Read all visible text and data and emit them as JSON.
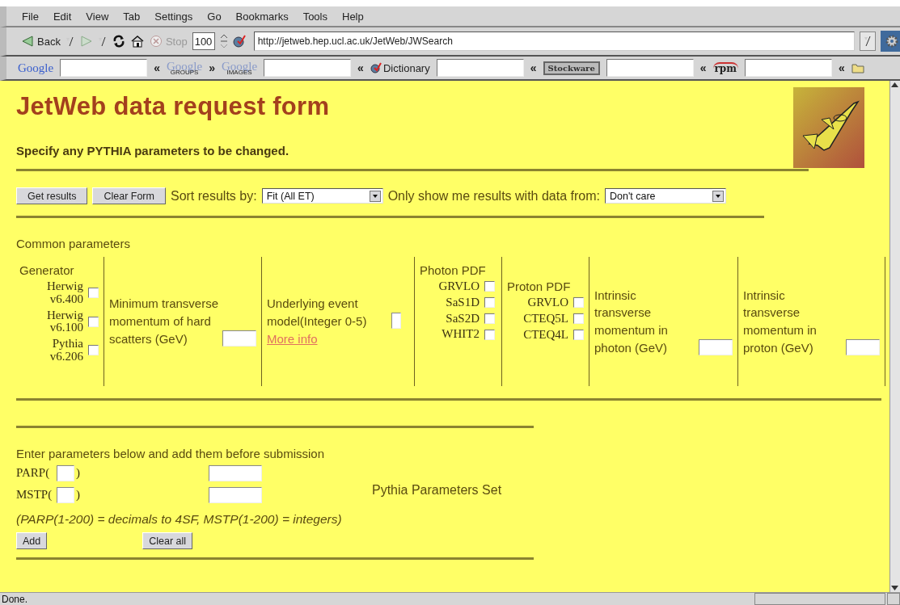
{
  "menu_bar": [
    "File",
    "Edit",
    "View",
    "Tab",
    "Settings",
    "Go",
    "Bookmarks",
    "Tools",
    "Help"
  ],
  "nav_toolbar": {
    "back": {
      "label": "Back",
      "disabled": false
    },
    "stop": {
      "label": "Stop",
      "disabled": true
    },
    "zoom": "100",
    "url": "http://jetweb.hep.ucl.ac.uk/JetWeb/JWSearch"
  },
  "search_toolbar": [
    {
      "kind": "google",
      "text": "Google"
    },
    {
      "kind": "field"
    },
    {
      "kind": "chevron",
      "text": "«"
    },
    {
      "kind": "google",
      "text": "Google",
      "sub": "GROUPS"
    },
    {
      "kind": "chevron",
      "text": "»"
    },
    {
      "kind": "google",
      "text": "Google",
      "sub": "IMAGES"
    },
    {
      "kind": "field"
    },
    {
      "kind": "chevron",
      "text": "«"
    },
    {
      "kind": "dictionary",
      "text": "Dictionary"
    },
    {
      "kind": "field"
    },
    {
      "kind": "chevron",
      "text": "«"
    },
    {
      "kind": "stockware",
      "text": "Stockware"
    },
    {
      "kind": "field"
    },
    {
      "kind": "chevron",
      "text": "«"
    },
    {
      "kind": "rpm",
      "text": "rpm"
    },
    {
      "kind": "field"
    },
    {
      "kind": "chevron",
      "text": "«"
    },
    {
      "kind": "folder"
    }
  ],
  "page": {
    "title": "JetWeb data request form",
    "subtitle": "Specify any PYTHIA parameters to be changed.",
    "buttons": [
      "Get results",
      "Clear Form"
    ],
    "sort": {
      "label": "Sort results by:",
      "value": "Fit (All ET)"
    },
    "data_filter": {
      "label": "Only show me results with data from:",
      "value": "Don't care"
    },
    "common_parameters": {
      "heading": "Common parameters",
      "columns": [
        {
          "kind": "checklist",
          "heading": "Generator",
          "options": [
            {
              "label": "Herwig v6.400",
              "checked": false
            },
            {
              "label": "Herwig v6.100",
              "checked": false
            },
            {
              "label": "Pythia v6.206",
              "checked": false
            }
          ]
        },
        {
          "kind": "number",
          "label": "Minimum transverse momentum of hard scatters (GeV)"
        },
        {
          "kind": "number",
          "label": "Underlying event model(Integer 0-5)",
          "link": "More info"
        },
        {
          "kind": "checklist",
          "heading": "Photon PDF",
          "options": [
            {
              "label": "GRVLO",
              "checked": false
            },
            {
              "label": "SaS1D",
              "checked": false
            },
            {
              "label": "SaS2D",
              "checked": false
            },
            {
              "label": "WHIT2",
              "checked": false
            }
          ]
        },
        {
          "kind": "checklist",
          "heading": "Proton PDF",
          "options": [
            {
              "label": "GRVLO",
              "checked": false
            },
            {
              "label": "CTEQ5L",
              "checked": false
            },
            {
              "label": "CTEQ4L",
              "checked": false
            }
          ]
        },
        {
          "kind": "number",
          "label": "Intrinsic transverse momentum in photon (GeV)"
        },
        {
          "kind": "number",
          "label": "Intrinsic transverse momentum in proton (GeV)"
        }
      ]
    },
    "pythia_parameters": {
      "intro": "Enter parameters below and add them before submission",
      "rows": [
        {
          "prefix": "PARP(",
          "suffix": ")"
        },
        {
          "prefix": "MSTP(",
          "suffix": ")"
        }
      ],
      "set_heading": "Pythia Parameters Set",
      "note": "(PARP(1-200) = decimals to 4SF, MSTP(1-200) = integers)",
      "buttons": [
        "Add",
        "Clear all"
      ]
    }
  },
  "status_bar": "Done."
}
